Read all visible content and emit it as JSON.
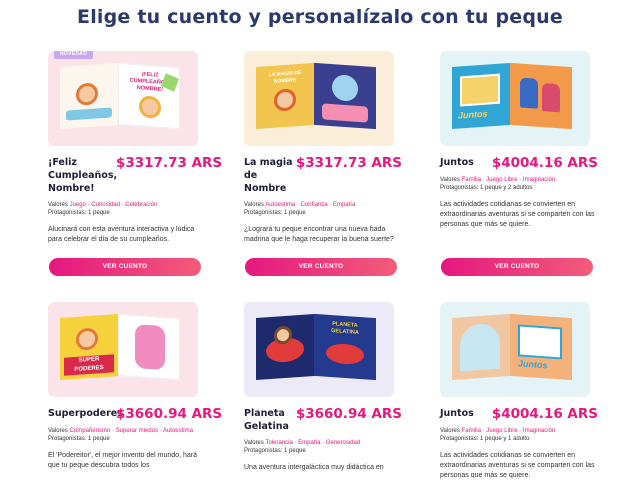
{
  "page": {
    "heading": "Elige tu cuento y personalízalo con tu peque"
  },
  "button_label": "VER CUENTO",
  "values_prefix": "Valores",
  "protagonists_prefix": "Protagonistas:",
  "cards": [
    {
      "badge": "NOVEDAD",
      "cover_text": "¡FELIZ CUMPLEAÑOS, NOMBRE!",
      "title": "¡Feliz Cumpleaños, Nombre!",
      "price": "$3317.73 ARS",
      "values": "Juego · Curiosidad · Celebración",
      "protagonists": "1 peque",
      "description": "Alucinará con esta aventura interactiva y lúdica para celebrar el día de su cumpleaños."
    },
    {
      "cover_text": "LA MAGIA DE NOMBRE",
      "title": "La magia de Nombre",
      "price": "$3317.73 ARS",
      "values": "Autoestima · Confianza · Empatía",
      "protagonists": "1 peque",
      "description": "¿Logrará tu peque encontrar una nueva hada madrina que le haga recuperar la buena suerte?"
    },
    {
      "cover_text": "Juntos",
      "title": "Juntos",
      "price": "$4004.16 ARS",
      "values": "Familia · Juego Libre · Imaginación",
      "protagonists": "1 peque y 2 adultos",
      "description": "Las actividades cotidianas se convierten en extraordinarias aventuras si se comparten con las personas que más se quiere."
    },
    {
      "cover_text": "SUPER PODERES",
      "title": "Superpoderes",
      "price": "$3660.94 ARS",
      "values": "Compañerismo · Superar miedos · Autoestima",
      "protagonists": "1 peque",
      "description": "El 'Podereitor', el mejor invento del mundo, hará que tu peque descubra todos los"
    },
    {
      "cover_text": "PLANETA GELATINA",
      "title": "Planeta Gelatina",
      "price": "$3660.94 ARS",
      "values": "Tolerancia · Empatía · Generosidad",
      "protagonists": "1 peque",
      "description": "Una aventura intergaláctica muy didáctica en"
    },
    {
      "cover_text": "Juntos",
      "title": "Juntos",
      "price": "$4004.16 ARS",
      "values": "Familia · Juego Libre · Imaginación",
      "protagonists": "1 peque y 1 adulto",
      "description": "Las actividades cotidianas se convierten en extraordinarias aventuras si se comparten con las personas que más se quiere."
    }
  ]
}
